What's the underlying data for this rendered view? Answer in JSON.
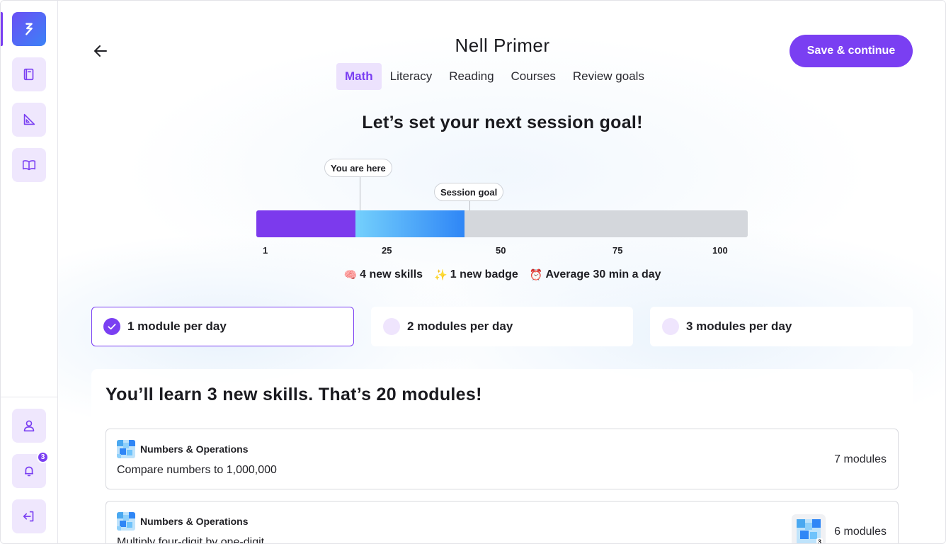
{
  "sidebar": {
    "items": [
      {
        "name": "logo",
        "icon": "bolt-logo-icon"
      },
      {
        "name": "book",
        "icon": "book-icon"
      },
      {
        "name": "ruler",
        "icon": "set-square-icon"
      },
      {
        "name": "open-book",
        "icon": "open-book-icon"
      }
    ],
    "bottom": [
      {
        "name": "profile",
        "icon": "user-icon"
      },
      {
        "name": "notifications",
        "icon": "bell-icon",
        "badge": "3"
      },
      {
        "name": "logout",
        "icon": "logout-icon"
      }
    ]
  },
  "header": {
    "title": "Nell Primer",
    "save_label": "Save & continue",
    "tabs": [
      {
        "label": "Math",
        "active": true
      },
      {
        "label": "Literacy",
        "active": false
      },
      {
        "label": "Reading",
        "active": false
      },
      {
        "label": "Courses",
        "active": false
      },
      {
        "label": "Review goals",
        "active": false
      }
    ]
  },
  "goal": {
    "headline": "Let’s set your next session goal!",
    "you_are_here_label": "You are here",
    "session_goal_label": "Session goal",
    "progress": {
      "current": 21,
      "goal": 43,
      "min": 1,
      "max": 100
    },
    "ticks": [
      "1",
      "25",
      "50",
      "75",
      "100"
    ],
    "stats": [
      {
        "emoji": "🧠",
        "text": "4 new skills"
      },
      {
        "emoji": "✨",
        "text": "1 new badge"
      },
      {
        "emoji": "⏰",
        "text": "Average 30 min a day"
      }
    ]
  },
  "options": [
    {
      "label": "1 module per day",
      "selected": true
    },
    {
      "label": "2 modules per day",
      "selected": false
    },
    {
      "label": "3 modules per day",
      "selected": false
    }
  ],
  "skills": {
    "title": "You’ll learn 3 new skills. That’s 20 modules!",
    "items": [
      {
        "category": "Numbers & Operations",
        "name": "Compare numbers to 1,000,000",
        "count": "7 modules",
        "badge": null
      },
      {
        "category": "Numbers & Operations",
        "name": "Multiply four-digit by one-digit",
        "count": "6 modules",
        "badge": "3"
      }
    ]
  },
  "colors": {
    "accent": "#7a3ff2",
    "accent_soft": "#efe7fd",
    "bar_blue_start": "#74d0fc",
    "bar_blue_end": "#2f86f6",
    "bar_track": "#d4d7dc"
  }
}
